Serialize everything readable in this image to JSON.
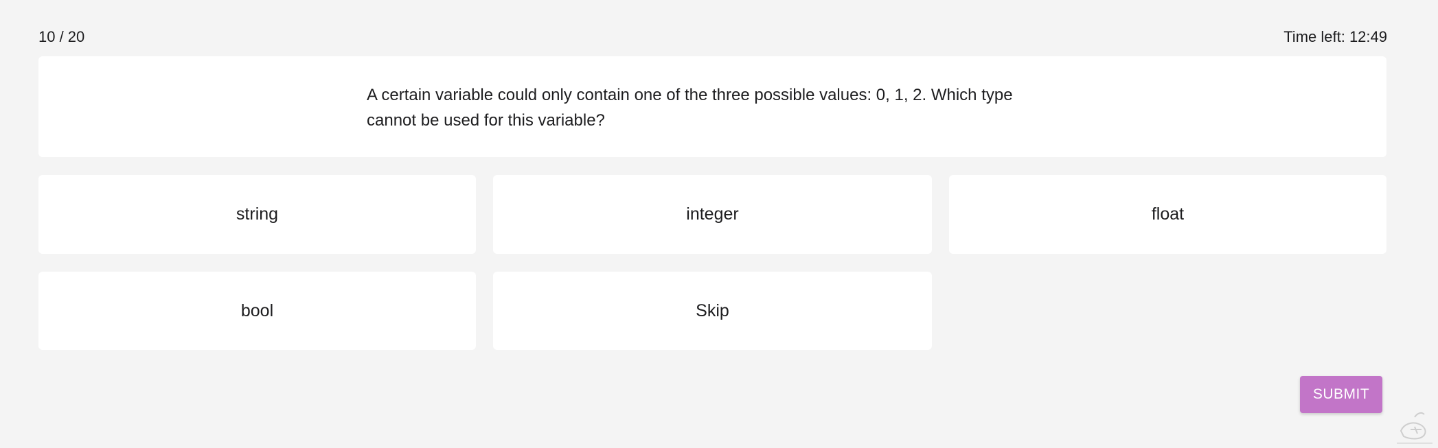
{
  "header": {
    "progress": "10 / 20",
    "timer": "Time left: 12:49"
  },
  "question": {
    "text": "A certain variable could only contain one of the three possible values: 0, 1, 2. Which type cannot be used for this variable?"
  },
  "options": [
    {
      "label": "string"
    },
    {
      "label": "integer"
    },
    {
      "label": "float"
    },
    {
      "label": "bool"
    },
    {
      "label": "Skip"
    }
  ],
  "submit": {
    "label": "SUBMIT",
    "color": "#c275c8"
  },
  "colors": {
    "background": "#f4f4f4",
    "card": "#ffffff",
    "text": "#1d1d1f"
  },
  "watermark": {
    "icon": "watermark-logo-icon"
  }
}
